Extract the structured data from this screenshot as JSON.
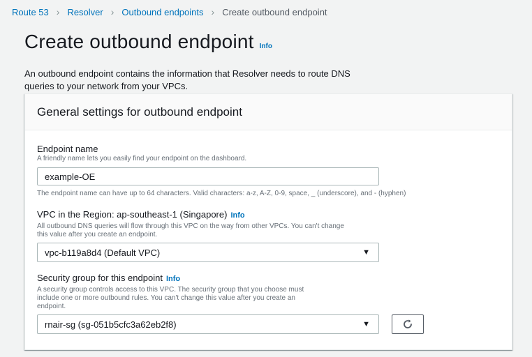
{
  "breadcrumb": {
    "items": [
      "Route 53",
      "Resolver",
      "Outbound endpoints"
    ],
    "current": "Create outbound endpoint"
  },
  "page": {
    "title": "Create outbound endpoint",
    "info_label": "Info",
    "intro": "An outbound endpoint contains the information that Resolver needs to route DNS queries to your network from your VPCs."
  },
  "panel": {
    "title": "General settings for outbound endpoint"
  },
  "endpoint_name": {
    "label": "Endpoint name",
    "description": "A friendly name lets you easily find your endpoint on the dashboard.",
    "value": "example-OE",
    "constraint": "The endpoint name can have up to 64 characters. Valid characters: a-z, A-Z, 0-9, space, _ (underscore), and - (hyphen)"
  },
  "vpc": {
    "label": "VPC in the Region: ap-southeast-1 (Singapore)",
    "info_label": "Info",
    "description_line1": "All outbound DNS queries will flow through this VPC on the way from other VPCs. You can't change",
    "description_line2": "this value after you create an endpoint.",
    "selected": "vpc-b119a8d4 (Default VPC)"
  },
  "security_group": {
    "label": "Security group for this endpoint",
    "info_label": "Info",
    "description_line1": "A security group controls access to this VPC. The security group that you choose must",
    "description_line2": "include one or more outbound rules. You can't change this value after you create an",
    "description_line3": "endpoint.",
    "selected": "rnair-sg (sg-051b5cfc3a62eb2f8)"
  },
  "icons": {
    "caret": "caret-down-icon",
    "refresh": "refresh-icon"
  },
  "colors": {
    "link": "#0073bb",
    "background": "#f2f3f3",
    "panel_header": "#fafafa"
  }
}
